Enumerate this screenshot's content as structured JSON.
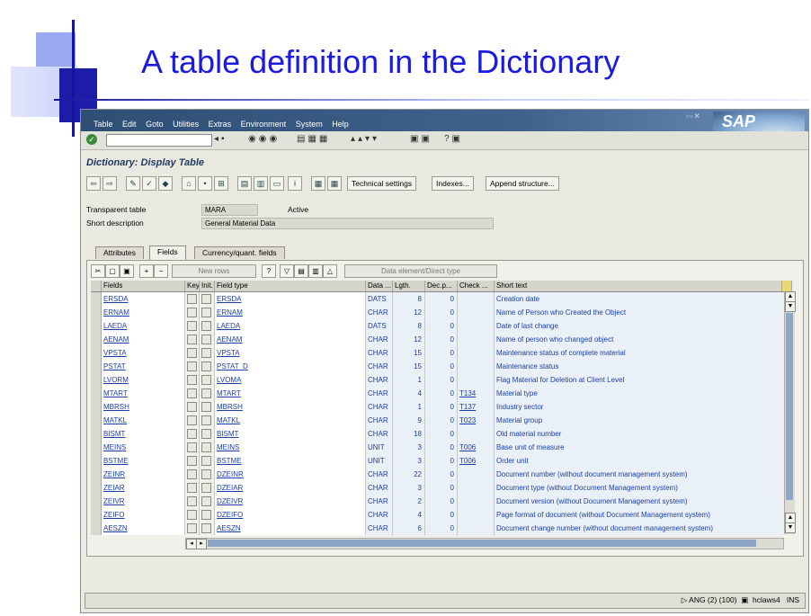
{
  "slide": {
    "title": "A table definition in the Dictionary"
  },
  "menubar": {
    "items": [
      "Table",
      "Edit",
      "Goto",
      "Utilities",
      "Extras",
      "Environment",
      "System",
      "Help"
    ],
    "logo": "SAP"
  },
  "screen": {
    "title": "Dictionary: Display Table"
  },
  "app_toolbar": {
    "technical_settings": "Technical settings",
    "indexes": "Indexes...",
    "append_structure": "Append structure..."
  },
  "header": {
    "transparent_table_label": "Transparent table",
    "transparent_table_value": "MARA",
    "status": "Active",
    "short_description_label": "Short description",
    "short_description_value": "General Material Data"
  },
  "tabs": [
    "Attributes",
    "Fields",
    "Currency/quant. fields"
  ],
  "grid_toolbar": {
    "new_rows": "New rows",
    "data_element_direct_type": "Data element/Direct type"
  },
  "grid": {
    "columns": [
      "Fields",
      "Key",
      "Init.",
      "Field type",
      "Data ...",
      "Lgth.",
      "Dec.p...",
      "Check ...",
      "Short text"
    ],
    "rows": [
      {
        "field": "ERSDA",
        "type": "ERSDA",
        "dtype": "DATS",
        "len": "8",
        "dec": "0",
        "check": "",
        "text": "Creation date"
      },
      {
        "field": "ERNAM",
        "type": "ERNAM",
        "dtype": "CHAR",
        "len": "12",
        "dec": "0",
        "check": "",
        "text": "Name of Person who Created the Object"
      },
      {
        "field": "LAEDA",
        "type": "LAEDA",
        "dtype": "DATS",
        "len": "8",
        "dec": "0",
        "check": "",
        "text": "Date of last change"
      },
      {
        "field": "AENAM",
        "type": "AENAM",
        "dtype": "CHAR",
        "len": "12",
        "dec": "0",
        "check": "",
        "text": "Name of person who changed object"
      },
      {
        "field": "VPSTA",
        "type": "VPSTA",
        "dtype": "CHAR",
        "len": "15",
        "dec": "0",
        "check": "",
        "text": "Maintenance status of complete material"
      },
      {
        "field": "PSTAT",
        "type": "PSTAT_D",
        "dtype": "CHAR",
        "len": "15",
        "dec": "0",
        "check": "",
        "text": "Maintenance status"
      },
      {
        "field": "LVORM",
        "type": "LVOMA",
        "dtype": "CHAR",
        "len": "1",
        "dec": "0",
        "check": "",
        "text": "Flag Material for Deletion at Client Level"
      },
      {
        "field": "MTART",
        "type": "MTART",
        "dtype": "CHAR",
        "len": "4",
        "dec": "0",
        "check": "T134",
        "text": "Material type"
      },
      {
        "field": "MBRSH",
        "type": "MBRSH",
        "dtype": "CHAR",
        "len": "1",
        "dec": "0",
        "check": "T137",
        "text": "Industry sector"
      },
      {
        "field": "MATKL",
        "type": "MATKL",
        "dtype": "CHAR",
        "len": "9",
        "dec": "0",
        "check": "T023",
        "text": "Material group"
      },
      {
        "field": "BISMT",
        "type": "BISMT",
        "dtype": "CHAR",
        "len": "18",
        "dec": "0",
        "check": "",
        "text": "Old material number"
      },
      {
        "field": "MEINS",
        "type": "MEINS",
        "dtype": "UNIT",
        "len": "3",
        "dec": "0",
        "check": "T006",
        "text": "Base unit of measure"
      },
      {
        "field": "BSTME",
        "type": "BSTME",
        "dtype": "UNIT",
        "len": "3",
        "dec": "0",
        "check": "T006",
        "text": "Order unit"
      },
      {
        "field": "ZEINR",
        "type": "DZEINR",
        "dtype": "CHAR",
        "len": "22",
        "dec": "0",
        "check": "",
        "text": "Document number (without document management system)"
      },
      {
        "field": "ZEIAR",
        "type": "DZEIAR",
        "dtype": "CHAR",
        "len": "3",
        "dec": "0",
        "check": "",
        "text": "Document type (without Document Management system)"
      },
      {
        "field": "ZEIVR",
        "type": "DZEIVR",
        "dtype": "CHAR",
        "len": "2",
        "dec": "0",
        "check": "",
        "text": "Document version (without Document Management system)"
      },
      {
        "field": "ZEIFO",
        "type": "DZEIFO",
        "dtype": "CHAR",
        "len": "4",
        "dec": "0",
        "check": "",
        "text": "Page format of document (without Document Management system)"
      },
      {
        "field": "AESZN",
        "type": "AESZN",
        "dtype": "CHAR",
        "len": "6",
        "dec": "0",
        "check": "",
        "text": "Document change number (without document management system)"
      }
    ]
  },
  "statusbar": {
    "system_info": "ANG (2) (100)",
    "server": "hclaws4",
    "mode": "INS"
  }
}
